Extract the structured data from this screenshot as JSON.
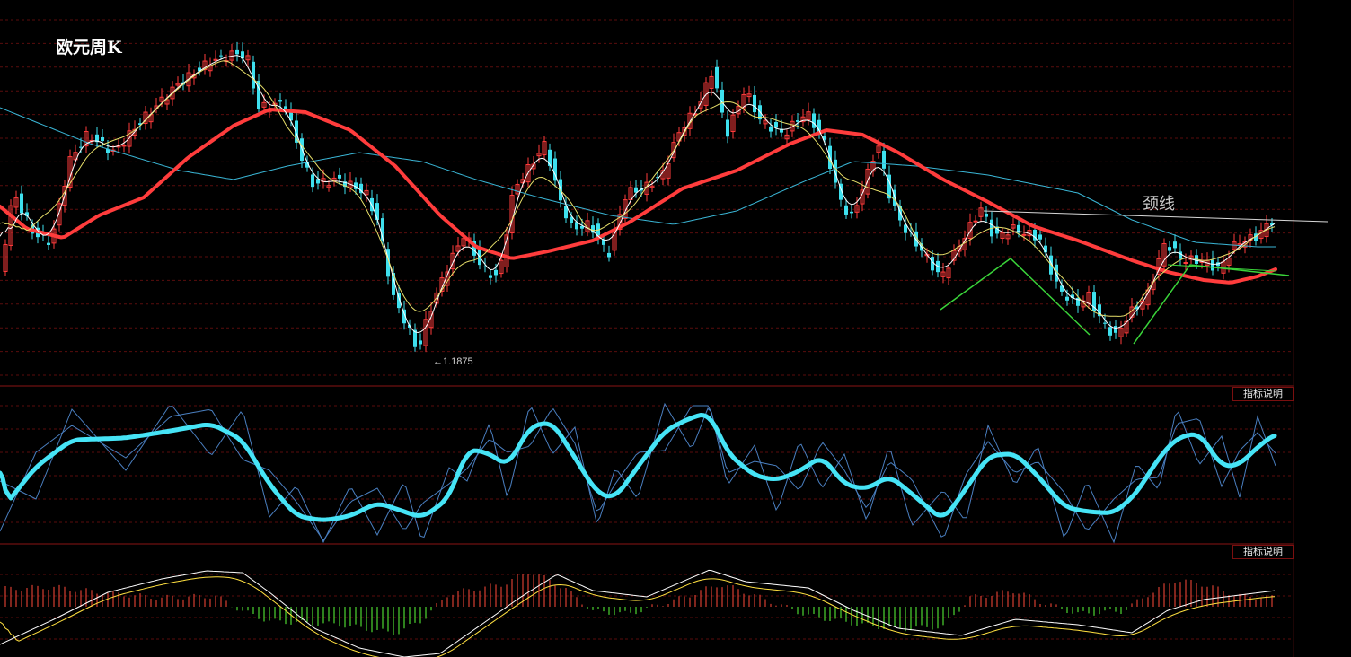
{
  "title": "欧元周K",
  "neckline_label": "颈线",
  "low_marker": "1.1875",
  "indicator_buttons": [
    "指标说明",
    "指标说明"
  ],
  "chart_data": [
    {
      "type": "candlestick",
      "title": "欧元周K",
      "annotations": [
        "颈线",
        "1.1875"
      ],
      "colors": {
        "up": "#ff3b3b",
        "down": "#3ee0ee",
        "ma_main": "#ff3c3c",
        "ma_slow": "#3ab6d6",
        "ma_fast1": "#ffffff",
        "ma_fast2": "#e8e06a"
      },
      "grid": "dashed-red-horizontal"
    },
    {
      "type": "line",
      "series": [
        {
          "values": []
        },
        {
          "values": []
        },
        {
          "values": []
        }
      ],
      "colors": [
        "#46e4f6",
        "#4a7fc0",
        "#4a7fc0"
      ]
    },
    {
      "type": "bar",
      "note": "MACD-style histogram with two lines",
      "colors": {
        "pos": "#ff4a3a",
        "neg": "#5cff3a",
        "dif": "#ffffff",
        "dea": "#ffe040"
      }
    }
  ]
}
